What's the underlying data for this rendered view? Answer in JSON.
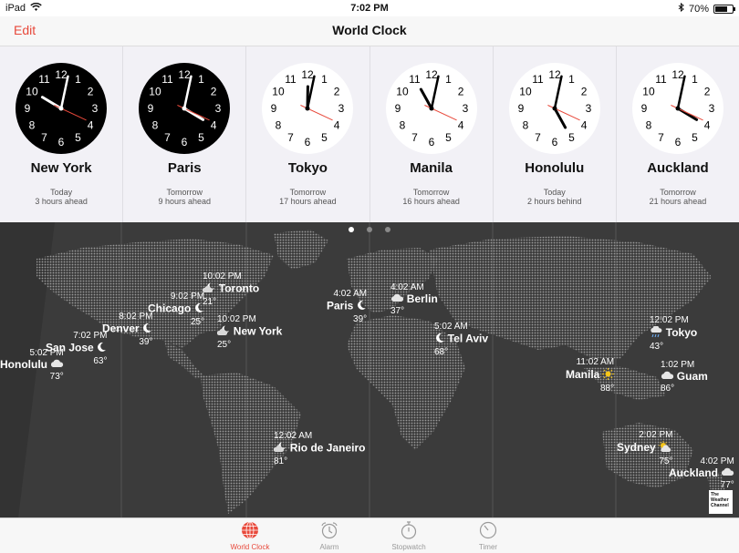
{
  "status": {
    "device": "iPad",
    "time": "7:02 PM",
    "battery": "70%",
    "battery_level": 0.7
  },
  "nav": {
    "edit": "Edit",
    "title": "World Clock"
  },
  "clocks": [
    {
      "city": "New York",
      "day": "Today",
      "offset": "3 hours ahead",
      "hour": 10,
      "minute": 2,
      "second": 10,
      "face": "dark"
    },
    {
      "city": "Paris",
      "day": "Tomorrow",
      "offset": "9 hours ahead",
      "hour": 4,
      "minute": 2,
      "second": 10,
      "face": "dark"
    },
    {
      "city": "Tokyo",
      "day": "Tomorrow",
      "offset": "17 hours ahead",
      "hour": 12,
      "minute": 2,
      "second": 10,
      "face": "light"
    },
    {
      "city": "Manila",
      "day": "Tomorrow",
      "offset": "16 hours ahead",
      "hour": 11,
      "minute": 2,
      "second": 10,
      "face": "light"
    },
    {
      "city": "Honolulu",
      "day": "Today",
      "offset": "2 hours behind",
      "hour": 5,
      "minute": 2,
      "second": 10,
      "face": "light"
    },
    {
      "city": "Auckland",
      "day": "Tomorrow",
      "offset": "21 hours ahead",
      "hour": 4,
      "minute": 2,
      "second": 10,
      "face": "light"
    }
  ],
  "map": {
    "page_count": 3,
    "active_page": 0,
    "cities": [
      {
        "time": "10:02 PM",
        "name": "Toronto",
        "temp": "21°",
        "icon": "moon-cloud-icon"
      },
      {
        "time": "9:02 PM",
        "name": "Chicago",
        "temp": "25°",
        "icon": "moon-icon"
      },
      {
        "time": "8:02 PM",
        "name": "Denver",
        "temp": "39°",
        "icon": "moon-icon"
      },
      {
        "time": "10:02 PM",
        "name": "New York",
        "temp": "25°",
        "icon": "moon-cloud-icon"
      },
      {
        "time": "7:02 PM",
        "name": "San Jose",
        "temp": "63°",
        "icon": "moon-icon"
      },
      {
        "time": "5:02 PM",
        "name": "Honolulu",
        "temp": "73°",
        "icon": "cloud-icon"
      },
      {
        "time": "4:02 AM",
        "name": "Paris",
        "temp": "39°",
        "icon": "moon-icon"
      },
      {
        "time": "4:02 AM",
        "name": "Berlin",
        "temp": "37°",
        "icon": "cloud-icon"
      },
      {
        "time": "5:02 AM",
        "name": "Tel Aviv",
        "temp": "68°",
        "icon": "moon-icon"
      },
      {
        "time": "12:02 AM",
        "name": "Rio de Janeiro",
        "temp": "81°",
        "icon": "moon-cloud-icon"
      },
      {
        "time": "12:02 PM",
        "name": "Tokyo",
        "temp": "43°",
        "icon": "rain-icon"
      },
      {
        "time": "11:02 AM",
        "name": "Manila",
        "temp": "88°",
        "icon": "sun-icon"
      },
      {
        "time": "1:02 PM",
        "name": "Guam",
        "temp": "86°",
        "icon": "cloud-icon"
      },
      {
        "time": "2:02 PM",
        "name": "Sydney",
        "temp": "75°",
        "icon": "sun-cloud-icon"
      },
      {
        "time": "4:02 PM",
        "name": "Auckland",
        "temp": "77°",
        "icon": "cloud-icon"
      }
    ],
    "weather_logo": [
      "The",
      "Weather",
      "Channel"
    ]
  },
  "tabs": [
    {
      "label": "World Clock",
      "icon": "globe-icon",
      "active": true
    },
    {
      "label": "Alarm",
      "icon": "alarm-clock-icon",
      "active": false
    },
    {
      "label": "Stopwatch",
      "icon": "stopwatch-icon",
      "active": false
    },
    {
      "label": "Timer",
      "icon": "timer-icon",
      "active": false
    }
  ],
  "colors": {
    "accent": "#e8493b",
    "second_hand": "#e8493b",
    "map_bg": "#3e3e3e",
    "land": "#8c8c8c"
  }
}
